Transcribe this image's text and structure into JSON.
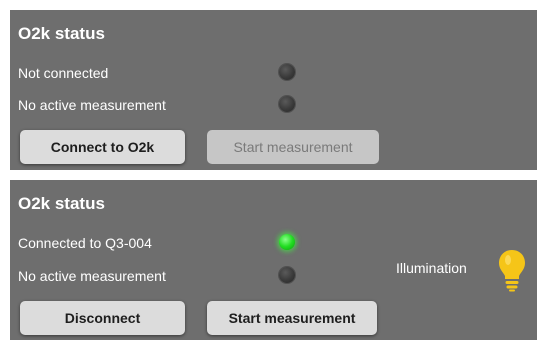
{
  "panel1": {
    "title": "O2k status",
    "connection_text": "Not connected",
    "measurement_text": "No active measurement",
    "connect_button_label": "Connect to O2k",
    "start_button_label": "Start measurement",
    "connection_led": "off",
    "measurement_led": "off"
  },
  "panel2": {
    "title": "O2k status",
    "connection_text": "Connected to Q3-004",
    "measurement_text": "No active measurement",
    "disconnect_button_label": "Disconnect",
    "start_button_label": "Start measurement",
    "illumination_label": "Illumination",
    "illumination_icon": "lightbulb-icon",
    "connection_led": "on",
    "measurement_led": "off"
  },
  "colors": {
    "panel_background": "#6e6e6e",
    "led_on": "#22dd22",
    "led_off": "#3a3a3a",
    "bulb": "#f5c518"
  }
}
